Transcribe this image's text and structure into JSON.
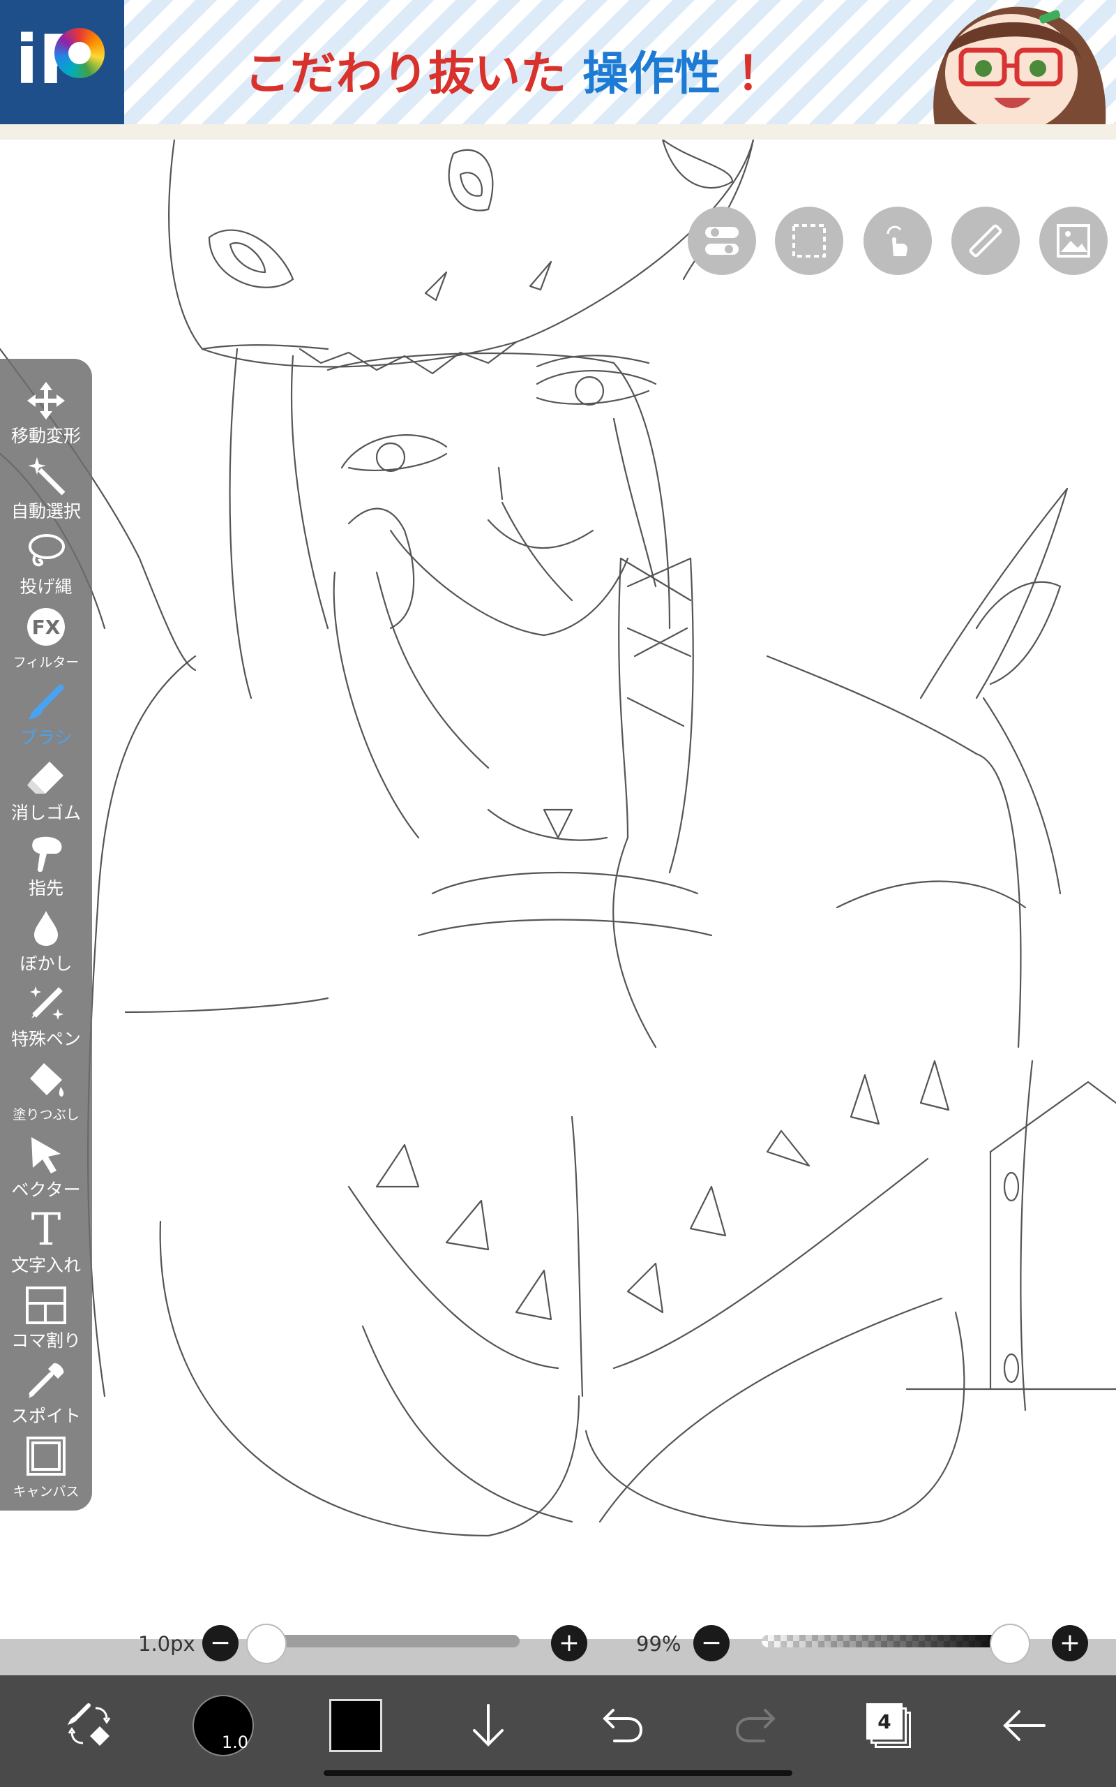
{
  "banner": {
    "text_part1": "こだわり抜いた",
    "text_part2": "操作性",
    "text_part3": "！",
    "logo_text": "iP"
  },
  "top_buttons": [
    {
      "name": "toggle-icon"
    },
    {
      "name": "selection-icon"
    },
    {
      "name": "touch-icon"
    },
    {
      "name": "ruler-icon"
    },
    {
      "name": "image-icon"
    }
  ],
  "tools": [
    {
      "id": "move",
      "label": "移動変形",
      "icon": "move-icon"
    },
    {
      "id": "magic-wand",
      "label": "自動選択",
      "icon": "magic-wand-icon"
    },
    {
      "id": "lasso",
      "label": "投げ縄",
      "icon": "lasso-icon"
    },
    {
      "id": "filter",
      "label": "フィルター",
      "icon": "fx-icon",
      "icon_text": "FX"
    },
    {
      "id": "brush",
      "label": "ブラシ",
      "icon": "brush-icon",
      "active": true
    },
    {
      "id": "eraser",
      "label": "消しゴム",
      "icon": "eraser-icon"
    },
    {
      "id": "smudge",
      "label": "指先",
      "icon": "finger-icon"
    },
    {
      "id": "blur",
      "label": "ぼかし",
      "icon": "drop-icon"
    },
    {
      "id": "special-pen",
      "label": "特殊ペン",
      "icon": "special-pen-icon"
    },
    {
      "id": "fill",
      "label": "塗りつぶし",
      "icon": "bucket-icon"
    },
    {
      "id": "vector",
      "label": "ベクター",
      "icon": "arrow-cursor-icon"
    },
    {
      "id": "text",
      "label": "文字入れ",
      "icon": "text-icon",
      "icon_text": "T"
    },
    {
      "id": "frame",
      "label": "コマ割り",
      "icon": "frame-divider-icon"
    },
    {
      "id": "eyedropper",
      "label": "スポイト",
      "icon": "eyedropper-icon"
    },
    {
      "id": "canvas",
      "label": "キャンバス",
      "icon": "canvas-icon"
    }
  ],
  "brush_size": {
    "label": "1.0px",
    "minus": "−",
    "plus": "+",
    "value_fraction": 0.0
  },
  "opacity": {
    "label": "99%",
    "minus": "−",
    "plus": "+",
    "value_fraction": 0.99
  },
  "bottom_bar": {
    "brush_size_indicator": "1.0",
    "color": "#000000",
    "layer_count": "4"
  },
  "colors": {
    "toolbar_bg": "#6e6e6e",
    "active_tool": "#4aa3f0",
    "bottom_bar_bg": "#4a4a4a",
    "slider_bar_bg": "#c7c7c7"
  }
}
